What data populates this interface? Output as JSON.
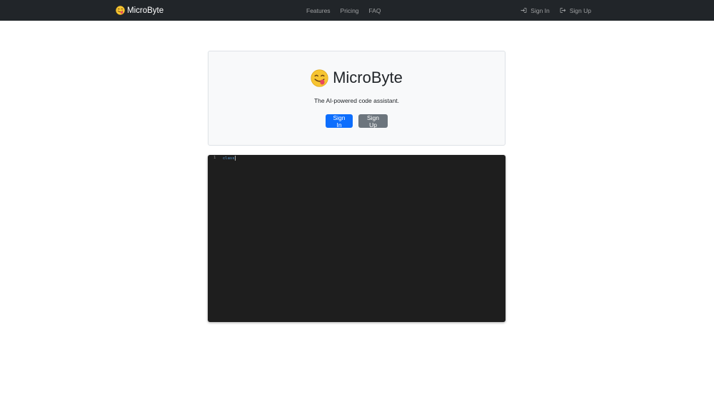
{
  "navbar": {
    "brand": "MicroByte",
    "links": [
      "Features",
      "Pricing",
      "FAQ"
    ],
    "sign_in": "Sign In",
    "sign_up": "Sign Up"
  },
  "hero": {
    "title": "MicroByte",
    "tagline": "The AI-powered code assistant.",
    "sign_in_button": "Sign In",
    "sign_up_button": "Sign Up"
  },
  "editor": {
    "line_number": "1",
    "code": "class"
  },
  "colors": {
    "navbar_bg": "#212529",
    "primary": "#0d6efd",
    "secondary": "#6c757d",
    "editor_bg": "#1e1e1e",
    "keyword": "#569cd6"
  },
  "icons": {
    "brand": "face-savoring-food-emoji",
    "sign_in": "box-arrow-in-right-icon",
    "sign_up": "box-arrow-right-icon"
  }
}
